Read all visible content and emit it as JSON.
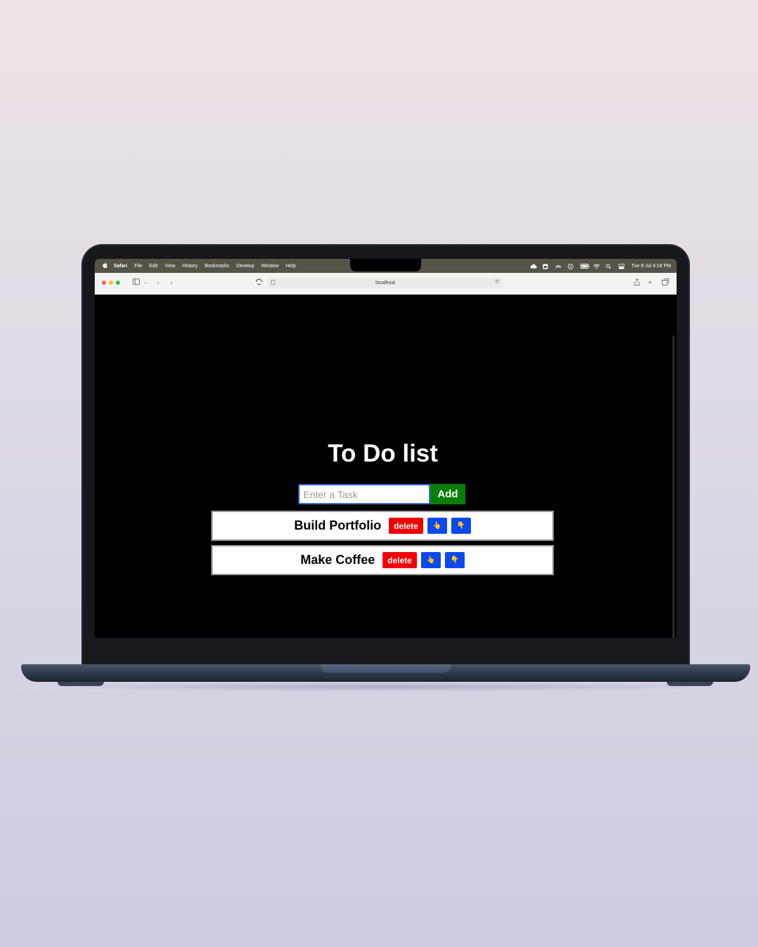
{
  "menubar": {
    "apple_icon": "apple-logo",
    "items": [
      "Safari",
      "File",
      "Edit",
      "View",
      "History",
      "Bookmarks",
      "Develop",
      "Window",
      "Help"
    ],
    "clock": "Tue 8 Jul  4:18 PM"
  },
  "browser": {
    "url": "localhost"
  },
  "app": {
    "title": "To Do list",
    "input_placeholder": "Enter a Task",
    "add_label": "Add",
    "tasks": [
      {
        "text": "Build Portfolio",
        "delete_label": "delete",
        "up_label": "👆",
        "down_label": "👇"
      },
      {
        "text": "Make Coffee",
        "delete_label": "delete",
        "up_label": "👆",
        "down_label": "👇"
      }
    ]
  },
  "colors": {
    "add_button": "#0a7e0a",
    "delete_button": "#f20000",
    "move_button": "#0b49f0",
    "page_background": "#000000"
  }
}
